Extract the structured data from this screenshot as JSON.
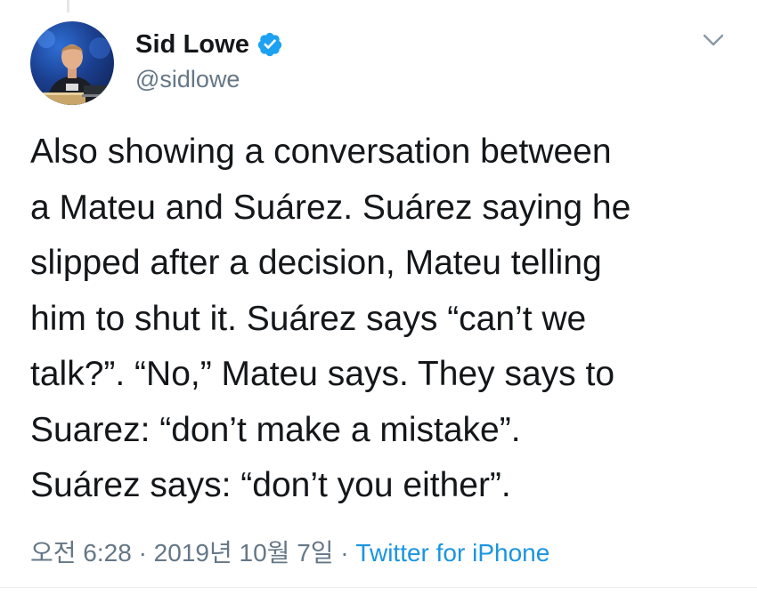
{
  "tweet": {
    "author": {
      "display_name": "Sid Lowe",
      "handle": "@sidlowe",
      "verified": true
    },
    "text": "Also showing a conversation between\na Mateu and Suárez. Suárez saying he\nslipped after a decision, Mateu telling\nhim to shut it. Suárez says “can’t we\ntalk?”. “No,” Mateu says. They says to\nSuarez: “don’t make a mistake”.\nSuárez says: “don’t you either”.",
    "timestamp": "오전 6:28 · 2019년 10월 7일",
    "separator": " · ",
    "source": "Twitter for iPhone"
  },
  "icons": {
    "verified": "verified-badge-icon",
    "menu": "chevron-down-icon"
  },
  "colors": {
    "text_primary": "#14171a",
    "text_secondary": "#657786",
    "link": "#1b95e0",
    "verified_badge": "#1da1f2"
  }
}
